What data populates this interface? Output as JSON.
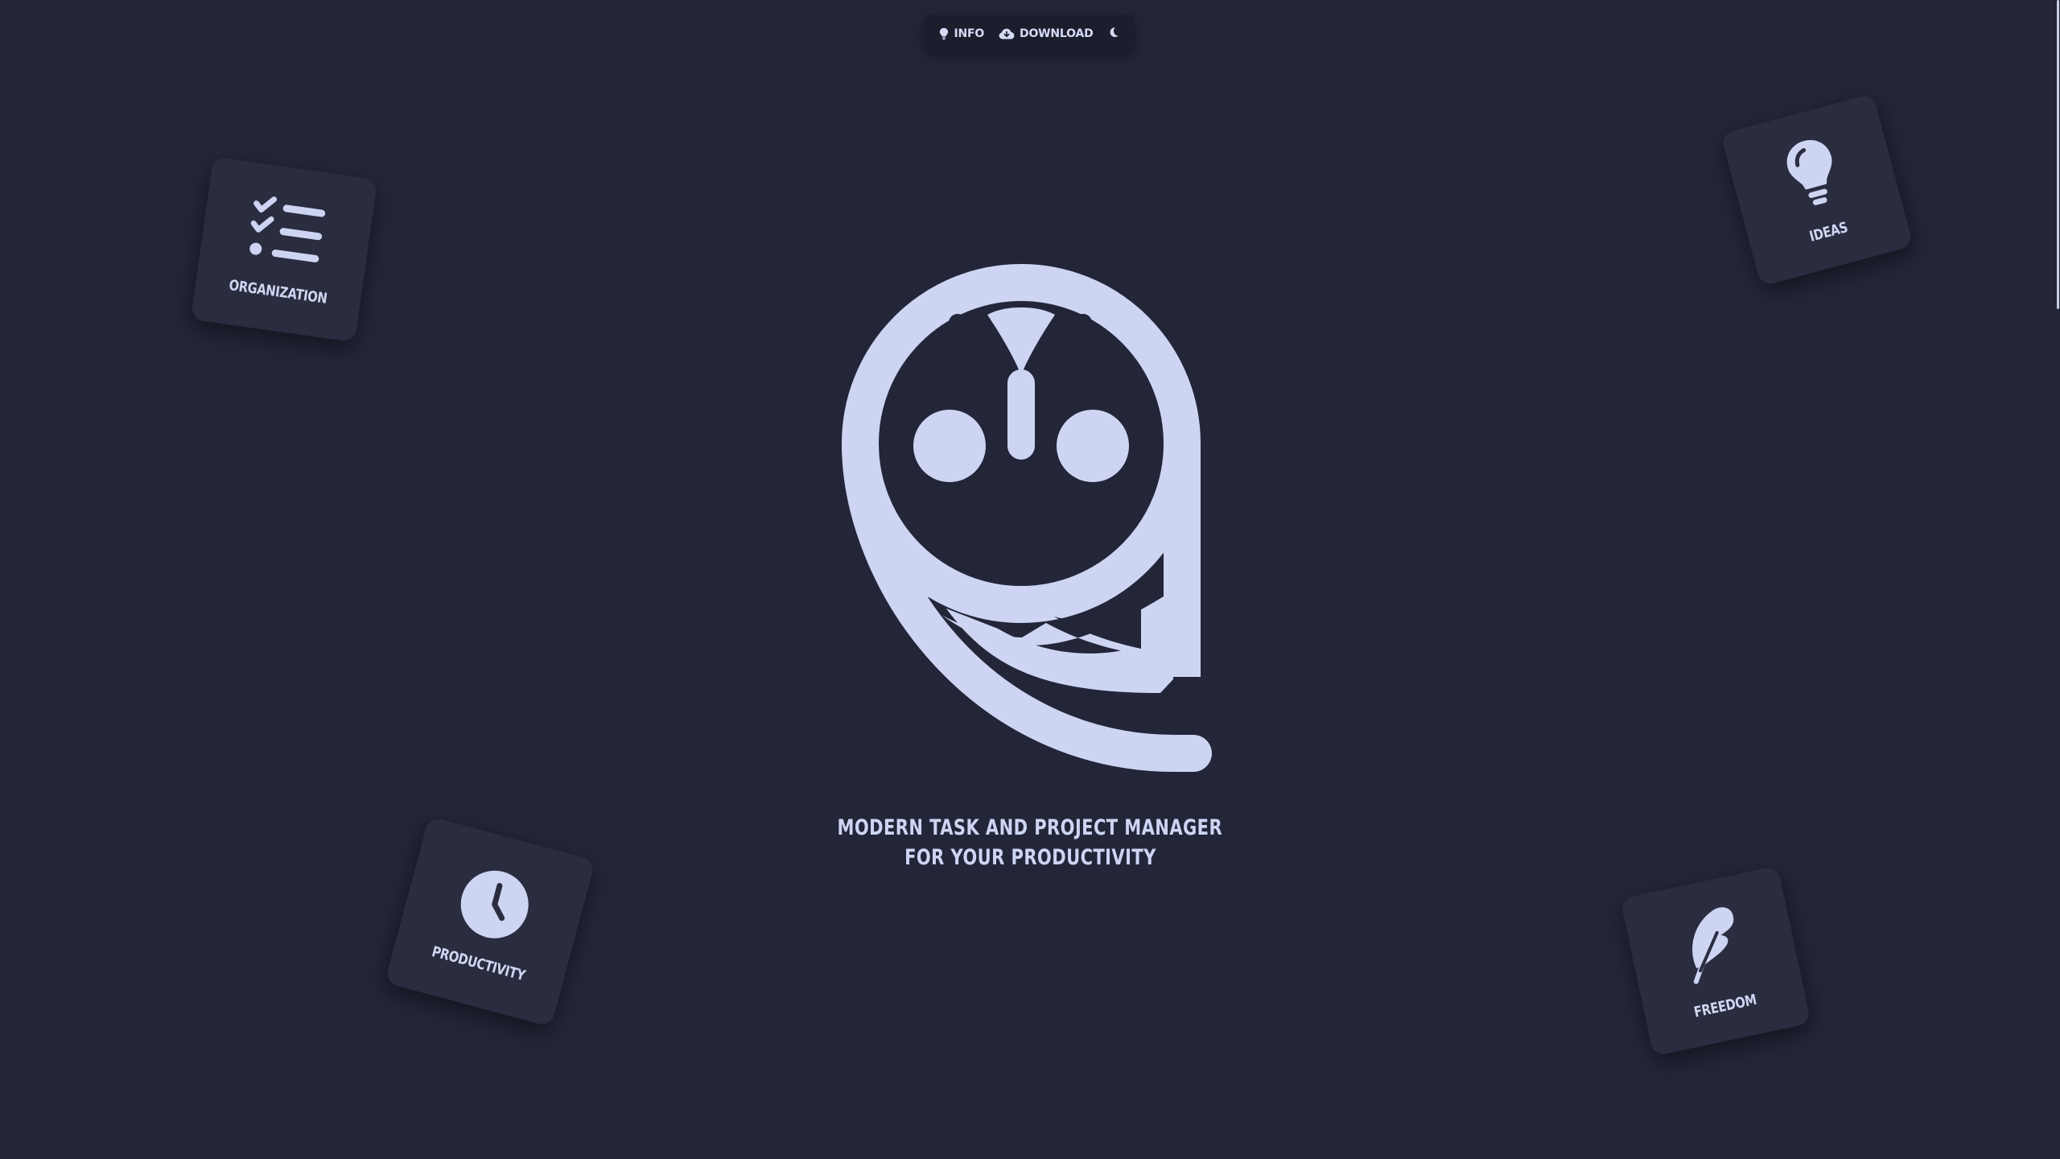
{
  "nav": {
    "info_label": "INFO",
    "download_label": "DOWNLOAD",
    "icons": [
      "lightbulb-icon",
      "cloud-download-icon",
      "moon-icon"
    ]
  },
  "hero": {
    "logo": "owl-logo",
    "tagline_line1": "MODERN TASK AND PROJECT MANAGER",
    "tagline_line2": "FOR YOUR PRODUCTIVITY"
  },
  "features": {
    "organization": {
      "label": "ORGANIZATION",
      "icon": "checklist-icon"
    },
    "ideas": {
      "label": "IDEAS",
      "icon": "lightbulb-icon"
    },
    "productivity": {
      "label": "PRODUCTIVITY",
      "icon": "clock-icon"
    },
    "freedom": {
      "label": "FREEDOM",
      "icon": "feather-icon"
    }
  },
  "colors": {
    "background": "#232639",
    "card": "#2a2c3f",
    "accent": "#cdd5f3"
  }
}
